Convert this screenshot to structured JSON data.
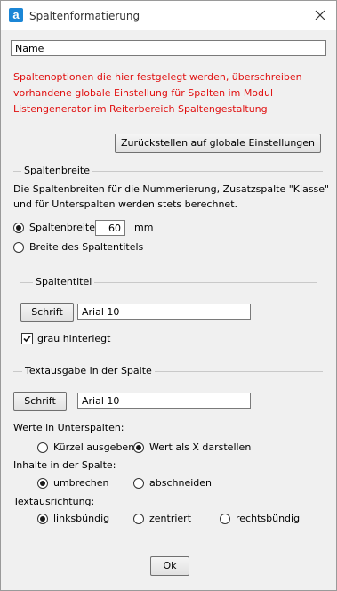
{
  "window": {
    "title": "Spaltenformatierung",
    "app_icon_letter": "a"
  },
  "name_field": {
    "value": "Name"
  },
  "warning": {
    "line1": "Spaltenoptionen die hier festgelegt werden, überschreiben",
    "line2": "vorhandene globale Einstellung für Spalten im Modul",
    "line3": "Listengenerator im Reiterbereich Spaltengestaltung",
    "color": "#e01010"
  },
  "reset_button": "Zurückstellen auf globale Einstellungen",
  "column_width": {
    "heading": "Spaltenbreite",
    "info1": "Die Spaltenbreiten für die Nummerierung, Zusatzspalte \"Klasse\"",
    "info2": "und für Unterspalten werden stets berechnet.",
    "option_width_label": "Spaltenbreite",
    "width_value": "60",
    "unit": "mm",
    "option_title_label": "Breite des Spaltentitels",
    "selected": "Spaltenbreite"
  },
  "column_title": {
    "heading": "Spaltentitel",
    "font_button": "Schrift",
    "font_value": "Arial 10",
    "grey_bg_label": "grau hinterlegt",
    "grey_bg_checked": true
  },
  "text_output": {
    "heading": "Textausgabe in der Spalte",
    "font_button": "Schrift",
    "font_value": "Arial 10",
    "subcolumn_label": "Werte in Unterspalten:",
    "subcolumn_options": [
      "Kürzel ausgeben",
      "Wert als X darstellen"
    ],
    "subcolumn_selected": "Wert als X darstellen",
    "content_label": "Inhalte in der Spalte:",
    "content_options": [
      "umbrechen",
      "abschneiden"
    ],
    "content_selected": "umbrechen",
    "align_label": "Textausrichtung:",
    "align_options": [
      "linksbündig",
      "zentriert",
      "rechtsbündig"
    ],
    "align_selected": "linksbündig"
  },
  "ok_button": "Ok"
}
